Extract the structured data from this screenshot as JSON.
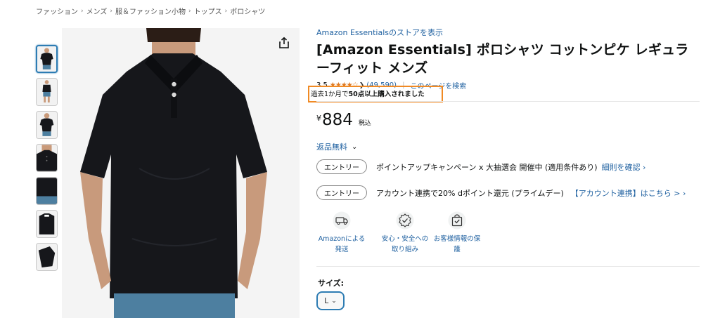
{
  "breadcrumb": [
    "ファッション",
    "メンズ",
    "服＆ファッション小物",
    "トップス",
    "ポロシャツ"
  ],
  "breadcrumb_separator": "›",
  "store_link": "Amazon Essentialsのストアを表示",
  "title": "[Amazon Essentials] ポロシャツ コットンピケ レギュラーフィット メンズ",
  "rating": {
    "value": "3.5",
    "stars": "★★★★☆",
    "count": "(49,590)",
    "separator": "|",
    "search_page": "このページを検索"
  },
  "purchase_badge": {
    "prefix": "過去1か月で",
    "bold": "50点以上購入されました"
  },
  "price": {
    "currency": "¥",
    "amount": "884",
    "tax": "税込"
  },
  "returns": "返品無料",
  "promos": [
    {
      "pill": "エントリー",
      "text": "ポイントアップキャンペーン x 大抽選会 開催中 (適用条件あり)",
      "link": "細則を確認 ›"
    },
    {
      "pill": "エントリー",
      "text": "アカウント連携で20% dポイント還元 (プライムデー)",
      "link": "【アカウント連携】はこちら > ›"
    }
  ],
  "features": [
    {
      "icon": "truck-icon",
      "line1": "Amazonによる",
      "line2": "発送"
    },
    {
      "icon": "shield-badge-icon",
      "line1": "安心・安全への",
      "line2": "取り組み"
    },
    {
      "icon": "secure-bag-icon",
      "line1": "お客様情報の保",
      "line2": "護"
    }
  ],
  "size": {
    "label": "サイズ:",
    "selected": "L"
  },
  "colors": {
    "link": "#2162a1",
    "star": "#de7921",
    "badge_border": "#f08a24",
    "selected_border": "#2d7cb3",
    "shirt": "#16171b",
    "shorts": "#4d7fa0"
  }
}
